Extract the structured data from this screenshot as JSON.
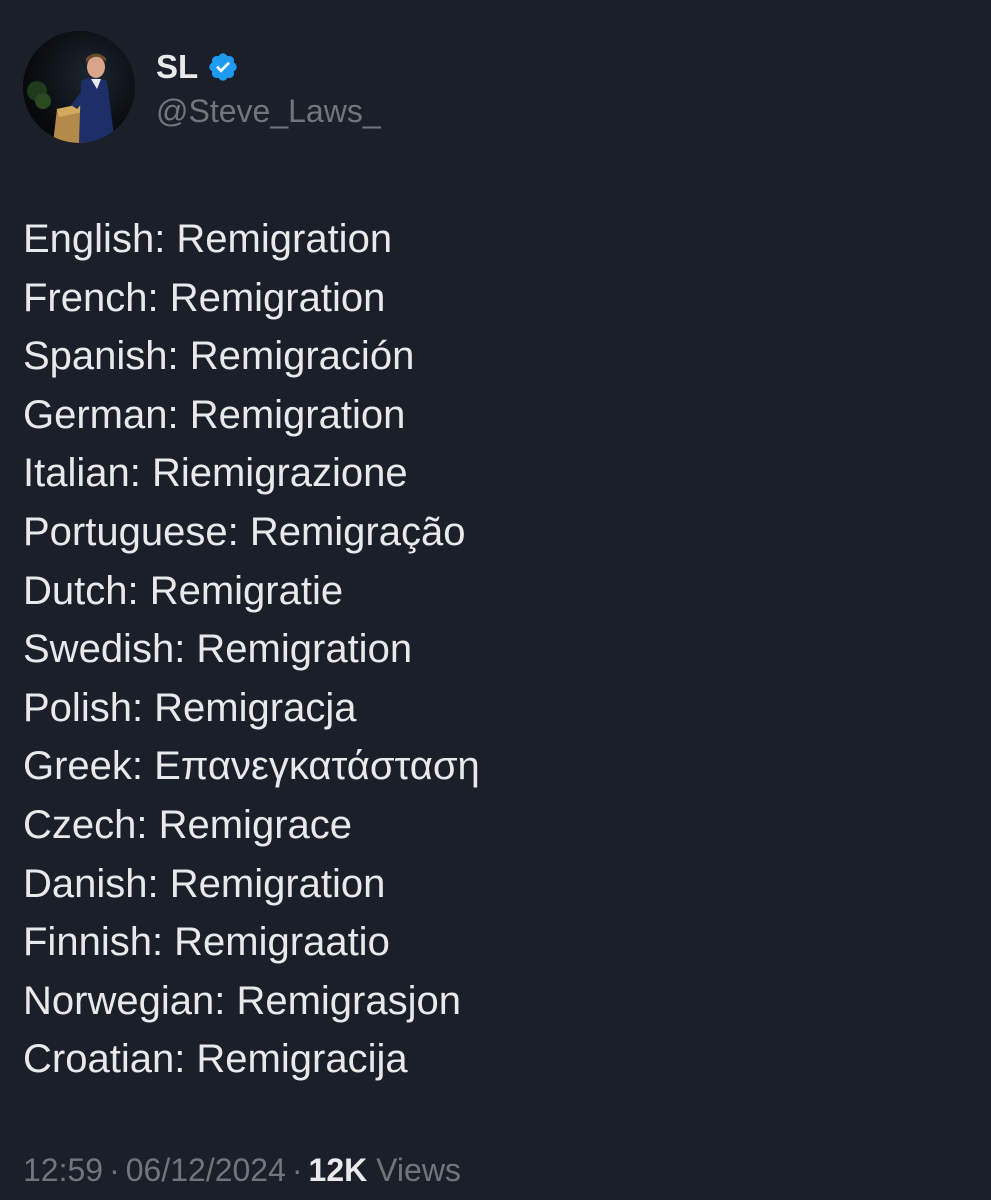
{
  "author": {
    "display_name": "SL",
    "handle": "@Steve_Laws_",
    "verified": true,
    "avatar_icon": "profile-photo-icon",
    "verified_icon": "verified-badge-icon",
    "verified_color": "#1d9bf0"
  },
  "tweet": {
    "lines": [
      "English: Remigration",
      "French: Remigration",
      "Spanish: Remigración",
      "German: Remigration",
      "Italian: Riemigrazione",
      "Portuguese: Remigração",
      "Dutch: Remigratie",
      "Swedish: Remigration",
      "Polish: Remigracja",
      "Greek: Επανεγκατάσταση",
      "Czech: Remigrace",
      "Danish: Remigration",
      "Finnish: Remigraatio",
      "Norwegian: Remigrasjon",
      "Croatian: Remigracija"
    ]
  },
  "meta": {
    "time": "12:59",
    "separator": "·",
    "date": "06/12/2024",
    "views_count": "12K",
    "views_label": "Views"
  },
  "colors": {
    "background": "#1a1f29",
    "text_primary": "#e7e9ea",
    "text_secondary": "#71767b"
  }
}
